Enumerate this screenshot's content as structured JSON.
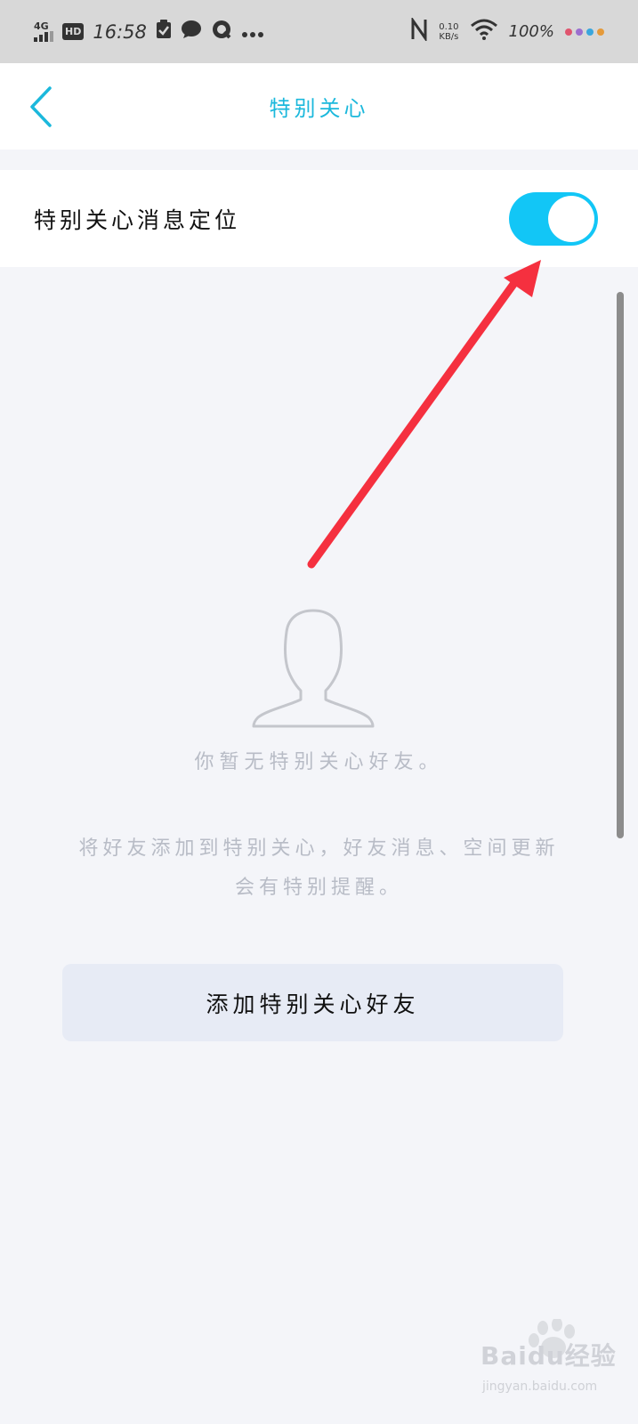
{
  "status_bar": {
    "network": "4G",
    "hd": "HD",
    "time": "16:58",
    "speed_value": "0.10",
    "speed_unit": "KB/s",
    "battery": "100%",
    "dot_colors": [
      "#e0556e",
      "#9b6fcf",
      "#3aa6dd",
      "#e59a3a"
    ]
  },
  "nav": {
    "title": "特别关心",
    "accent": "#1bb8dc"
  },
  "setting": {
    "label": "特别关心消息定位",
    "toggle_on": true,
    "toggle_color": "#12c6f6"
  },
  "empty_state": {
    "message": "你暂无特别关心好友。",
    "hint_line1": "将好友添加到特别关心，好友消息、空间更新",
    "hint_line2": "会有特别提醒。",
    "button_label": "添加特别关心好友"
  },
  "annotation": {
    "arrow_color": "#f5303f"
  },
  "watermark": {
    "brand": "Baidu经验",
    "url": "jingyan.baidu.com"
  }
}
